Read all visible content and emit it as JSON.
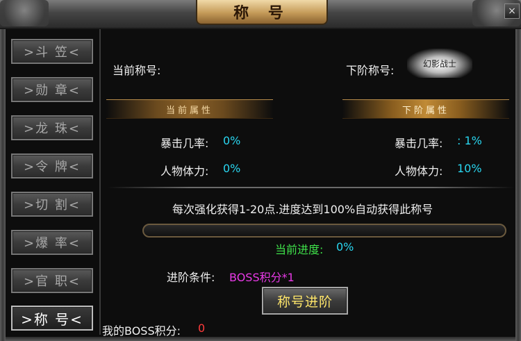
{
  "window": {
    "title": "称 号",
    "close_label": "×"
  },
  "sidebar": {
    "items": [
      {
        "label": ">斗 笠<",
        "active": false
      },
      {
        "label": ">勋 章<",
        "active": false
      },
      {
        "label": ">龙 珠<",
        "active": false
      },
      {
        "label": ">令 牌<",
        "active": false
      },
      {
        "label": ">切 割<",
        "active": false
      },
      {
        "label": ">爆 率<",
        "active": false
      },
      {
        "label": ">官 职<",
        "active": false
      },
      {
        "label": ">称 号<",
        "active": true
      }
    ]
  },
  "header": {
    "current_title_label": "当前称号:",
    "next_title_label": "下阶称号:",
    "next_title_badge": "幻影战士"
  },
  "current_attrs": {
    "heading": "当前属性",
    "crit_label": "暴击几率:",
    "crit_value": "0%",
    "stamina_label": "人物体力:",
    "stamina_value": "0%"
  },
  "next_attrs": {
    "heading": "下阶属性",
    "crit_label": "暴击几率:",
    "crit_value": ": 1%",
    "stamina_label": "人物体力:",
    "stamina_value": "10%"
  },
  "info": {
    "description": "每次强化获得1-20点.进度达到100%自动获得此称号",
    "progress_label": "当前进度:",
    "progress_value": "0%",
    "progress_fraction": 0,
    "condition_label": "进阶条件:",
    "condition_value": "BOSS积分*1",
    "advance_button": "称号进阶",
    "boss_points_label": "我的BOSS积分:",
    "boss_points_value": "0"
  },
  "colors": {
    "cyan": "#29d6f0",
    "green": "#3fe24a",
    "magenta": "#e83ae6",
    "red": "#ff3b3b",
    "gold_text": "#ffe66a"
  }
}
